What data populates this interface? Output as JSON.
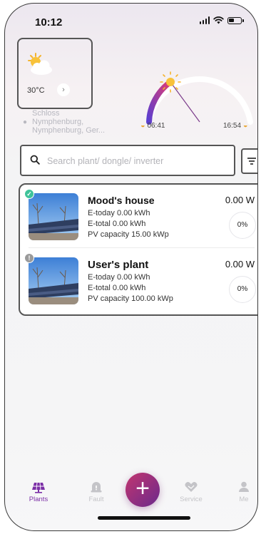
{
  "status_bar": {
    "time": "10:12"
  },
  "weather": {
    "temperature": "30°C",
    "chevron": "›",
    "icon": "partly-sunny-icon",
    "location_lines": [
      "Schloss",
      "Nymphenburg,",
      "Nymphenburg, Ger..."
    ],
    "sunrise": "06:41",
    "sunset": "16:54",
    "sun_progress_fraction": 0.33,
    "colors": {
      "arc_start": "#5b3fd0",
      "arc_end": "#e23a72",
      "sun": "#f5b32d"
    }
  },
  "search": {
    "placeholder": "Search plant/ dongle/ inverter",
    "value": ""
  },
  "plants": [
    {
      "name": "Mood's house",
      "power": "0.00 W",
      "e_today": "E-today 0.00 kWh",
      "e_total": "E-total 0.00 kWh",
      "pv_capacity": "PV capacity 15.00 kWp",
      "percent": "0%",
      "status": "online",
      "status_glyph": "✓"
    },
    {
      "name": "User's plant",
      "power": "0.00 W",
      "e_today": "E-today 0.00 kWh",
      "e_total": "E-total 0.00 kWh",
      "pv_capacity": "PV capacity 100.00 kWp",
      "percent": "0%",
      "status": "offline",
      "status_glyph": "!"
    }
  ],
  "fab": {
    "label": "+"
  },
  "tabs": [
    {
      "label": "Plants",
      "icon": "solar-panel-icon",
      "active": true
    },
    {
      "label": "Fault",
      "icon": "alert-icon",
      "active": false
    },
    {
      "label": "Service",
      "icon": "handshake-icon",
      "active": false
    },
    {
      "label": "Me",
      "icon": "user-icon",
      "active": false
    }
  ],
  "colors": {
    "accent": "#7b2fa6",
    "inactive": "#c4c4c8",
    "online": "#3fc39a",
    "offline": "#9a9a9a"
  }
}
